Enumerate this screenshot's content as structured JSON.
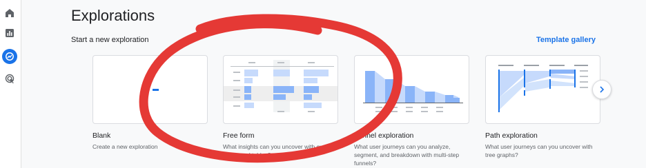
{
  "nav": {
    "items": [
      {
        "id": "home",
        "icon": "home-icon",
        "active": false
      },
      {
        "id": "reports",
        "icon": "bar-chart-icon",
        "active": false
      },
      {
        "id": "explore",
        "icon": "explore-icon",
        "active": true
      },
      {
        "id": "advertising",
        "icon": "target-cursor-icon",
        "active": false
      }
    ]
  },
  "header": {
    "title": "Explorations"
  },
  "section": {
    "label": "Start a new exploration",
    "template_link": "Template gallery"
  },
  "cards": [
    {
      "title": "Blank",
      "description": "Create a new exploration",
      "preview": "blank"
    },
    {
      "title": "Free form",
      "description": "What insights can you uncover with custom charts and tables?",
      "preview": "free-form"
    },
    {
      "title": "Funnel exploration",
      "description": "What user journeys can you analyze, segment, and breakdown with multi-step funnels?",
      "preview": "funnel"
    },
    {
      "title": "Path exploration",
      "description": "What user journeys can you uncover with tree graphs?",
      "preview": "path"
    }
  ],
  "carousel": {
    "next_icon": "chevron-right-icon"
  },
  "overlay": {
    "annotation": "red-hand-drawn-circle",
    "color": "#e53935"
  },
  "colors": {
    "accent": "#1a73e8",
    "chart_blue": "#8ab4f8",
    "chart_light": "#c6dafc"
  }
}
